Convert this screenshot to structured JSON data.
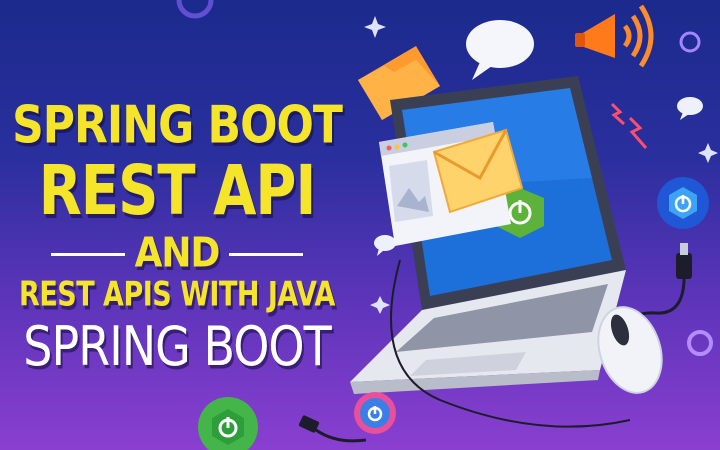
{
  "headline": {
    "line1": "SPRING BOOT",
    "line2": "REST API",
    "line3": "AND",
    "line4": "REST APIS WITH JAVA",
    "line5": "SPRING BOOT"
  },
  "colors": {
    "background_top": "#1b2a8c",
    "background_bottom": "#8a3fd0",
    "headline_yellow": "#f5e52a",
    "headline_white": "#ffffff",
    "spring_green": "#6abf3a"
  },
  "icons": [
    "laptop-icon",
    "envelope-icon",
    "megaphone-icon",
    "speech-bubble-icon",
    "spring-power-logo-icon",
    "mouse-icon",
    "usb-cable-icon",
    "sparkle-icon",
    "folder-icon",
    "browser-window-icon"
  ]
}
